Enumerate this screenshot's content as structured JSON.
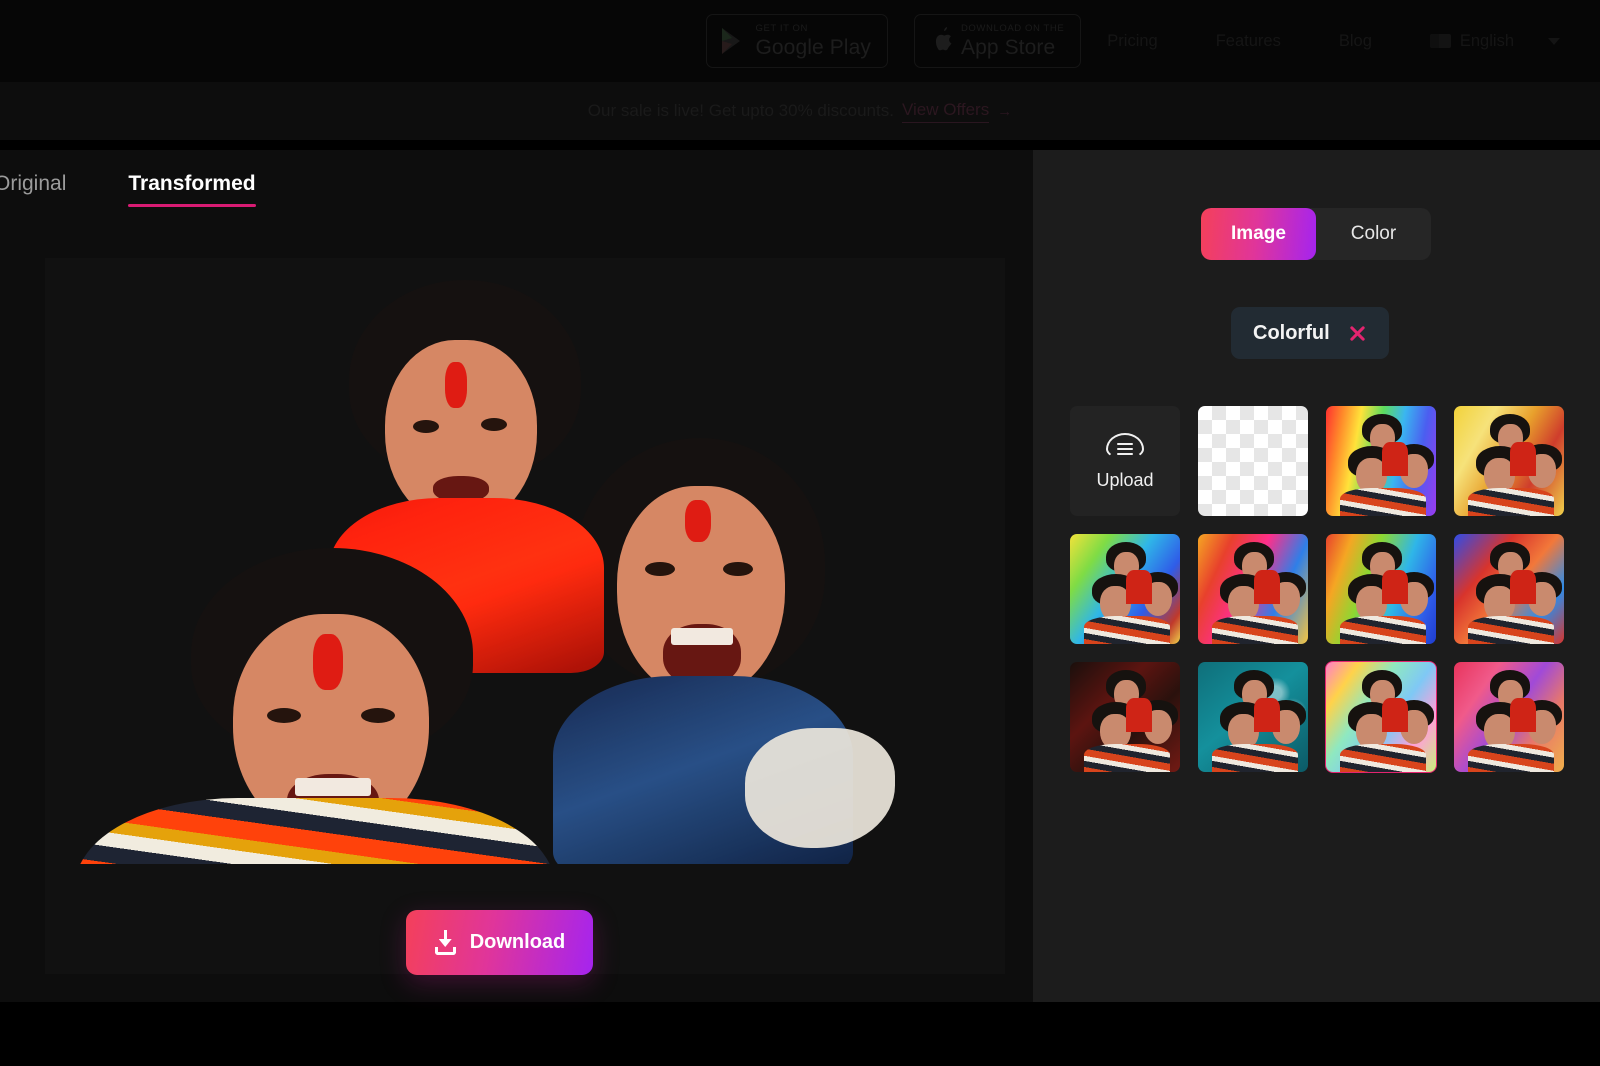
{
  "topnav": {
    "badges": [
      {
        "icon": "google-play-icon",
        "small": "GET IT ON",
        "big": "Google Play"
      },
      {
        "icon": "apple-icon",
        "small": "Download on the",
        "big": "App Store"
      }
    ],
    "links": [
      "Pricing",
      "Features",
      "Blog"
    ],
    "language": {
      "icon": "flag-icon",
      "label": "English",
      "chevron": "chevron-down-icon"
    }
  },
  "promo": {
    "text": "Our sale is live! Get upto 30% discounts.",
    "link": "View Offers",
    "arrow": "→"
  },
  "editor": {
    "tabs": [
      {
        "label": "Original",
        "active": false
      },
      {
        "label": "Transformed",
        "active": true
      }
    ],
    "download": {
      "label": "Download",
      "icon": "download-icon"
    }
  },
  "panel": {
    "segments": [
      {
        "label": "Image",
        "active": true
      },
      {
        "label": "Color",
        "active": false
      }
    ],
    "chip": {
      "label": "Colorful",
      "close_icon": "close-icon"
    },
    "upload": {
      "label": "Upload",
      "icon": "cloud-upload-icon"
    },
    "background_count": 11
  },
  "colors": {
    "accent_pink": "#e3246f",
    "gradient_start": "#f4405a",
    "gradient_mid": "#e0359a",
    "gradient_end": "#a524ef",
    "panel_bg": "#1c1c1c",
    "canvas_bg": "#0d0d0d",
    "tab_underline": "#d81b73"
  },
  "thumbnails": [
    {
      "name": "transparent",
      "type": "checker",
      "selected": false
    },
    {
      "name": "rainbow-stripes",
      "bg": "linear-gradient(100deg,#ff2f2f 0%,#ff8a2a 14%,#ffe23a 28%,#5ddc5d 45%,#3ab6f0 62%,#4b5ef0 80%,#9b3af0 100%)",
      "selected": false
    },
    {
      "name": "yellow-paint",
      "bg": "linear-gradient(120deg,#f2d23a 0%,#f6e27a 25%,#e8a02c 48%,#cf3d2c 70%,#f0d14a 100%)",
      "selected": false
    },
    {
      "name": "rainbow-swirl",
      "bg": "linear-gradient(125deg,#f2e23a 0%,#7fdc45 22%,#2fb6e8 45%,#2f5ce8 68%,#c0392b 88%,#f0d14a 100%)",
      "selected": false
    },
    {
      "name": "warm-splash",
      "bg": "linear-gradient(115deg,#f5a623 0%,#e8412c 22%,#ff2f8a 45%,#2f7fe8 70%,#f5c542 100%)",
      "selected": false
    },
    {
      "name": "rainbow-blue",
      "bg": "linear-gradient(110deg,#e8412c 0%,#f5a623 18%,#8cd832 38%,#2fb6e8 62%,#2f5ce8 85%,#1f3ccf 100%)",
      "selected": false
    },
    {
      "name": "blue-red-abstract",
      "bg": "linear-gradient(130deg,#2f4ce8 0%,#d8342c 30%,#f2783a 52%,#2f8ce8 76%,#d8342c 100%)",
      "selected": false
    },
    {
      "name": "dark-red",
      "bg": "linear-gradient(135deg,#1a0f0c 0%,#5c1410 35%,#2a110d 62%,#731a14 100%)",
      "selected": false
    },
    {
      "name": "teal-bokeh",
      "bg": "radial-gradient(circle at 70% 28%, rgba(255,255,255,.45) 0 6%, transparent 14%), radial-gradient(circle at 86% 46%, rgba(255,255,255,.4) 0 5%, transparent 13%), linear-gradient(140deg,#0f6f7a 0%,#14909c 45%,#0c5a66 100%)",
      "selected": false
    },
    {
      "name": "pastel-colorful",
      "bg": "linear-gradient(125deg,#ff7ec8 0%,#ffd24a 18%,#8fe8c0 38%,#7fc8f5 58%,#ffa0d8 78%,#c8f07a 100%)",
      "selected": true
    },
    {
      "name": "pink-red-smoke",
      "bg": "linear-gradient(125deg,#e8345c 0%,#f05a8a 25%,#a04ad8 50%,#e8786a 72%,#f0b04a 100%)",
      "selected": false
    }
  ]
}
